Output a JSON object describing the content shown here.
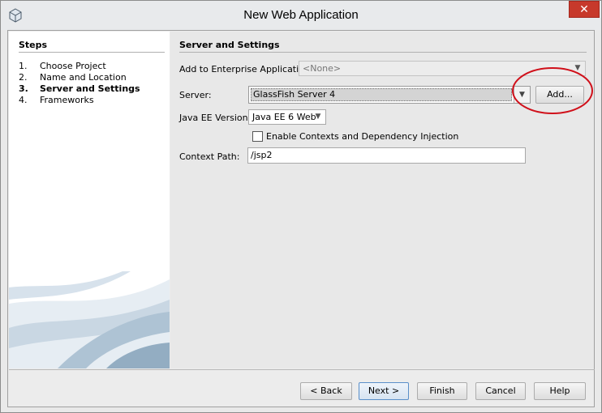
{
  "window": {
    "title": "New Web Application",
    "close_glyph": "✕",
    "icon": "netbeans-cube-icon"
  },
  "steps": {
    "title": "Steps",
    "items": [
      {
        "num": "1.",
        "label": "Choose Project",
        "active": false
      },
      {
        "num": "2.",
        "label": "Name and Location",
        "active": false
      },
      {
        "num": "3.",
        "label": "Server and Settings",
        "active": true
      },
      {
        "num": "4.",
        "label": "Frameworks",
        "active": false
      }
    ]
  },
  "panel": {
    "title": "Server and Settings",
    "enterprise_label": "Add to Enterprise Application:",
    "enterprise_value": "<None>",
    "server_label": "Server:",
    "server_value": "GlassFish Server 4",
    "add_button": "Add...",
    "javaee_label": "Java EE Version:",
    "javaee_value": "Java EE 6 Web",
    "cdi_label": "Enable Contexts and Dependency Injection",
    "cdi_checked": false,
    "context_label": "Context Path:",
    "context_value": "/jsp2"
  },
  "buttons": {
    "back": "< Back",
    "next": "Next >",
    "finish": "Finish",
    "cancel": "Cancel",
    "help": "Help"
  },
  "colors": {
    "close": "#c7392b",
    "annotation": "#d0101a"
  }
}
